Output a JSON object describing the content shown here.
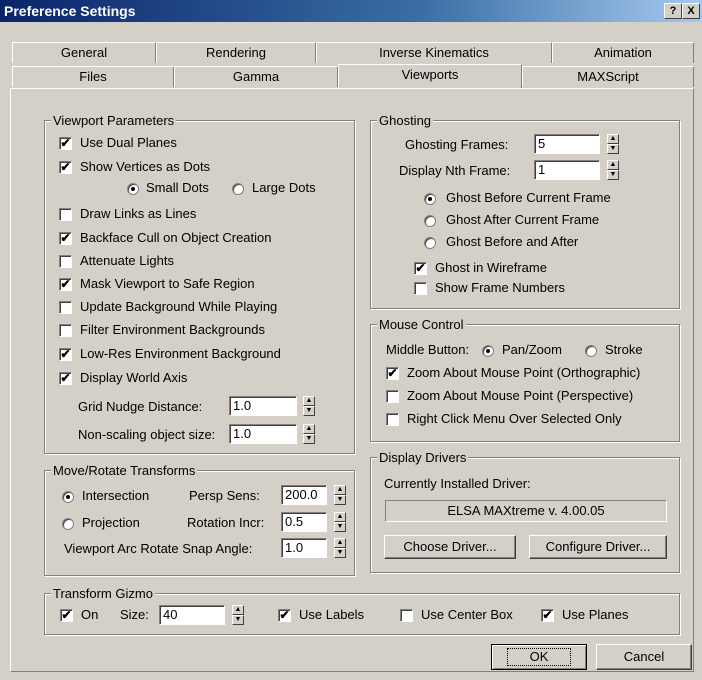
{
  "window": {
    "title": "Preference Settings",
    "help_label": "?",
    "close_label": "X"
  },
  "tabs_row1": [
    "General",
    "Rendering",
    "Inverse Kinematics",
    "Animation"
  ],
  "tabs_row2": [
    "Files",
    "Gamma",
    "Viewports",
    "MAXScript"
  ],
  "viewport_params": {
    "title": "Viewport Parameters",
    "use_dual_planes": "Use Dual Planes",
    "show_vertices": "Show Vertices as Dots",
    "small_dots": "Small Dots",
    "large_dots": "Large Dots",
    "draw_links": "Draw Links as Lines",
    "backface_cull": "Backface Cull on Object Creation",
    "attenuate_lights": "Attenuate Lights",
    "mask_viewport": "Mask Viewport to Safe Region",
    "update_background": "Update Background While Playing",
    "filter_env": "Filter Environment Backgrounds",
    "lowres_env": "Low-Res Environment Background",
    "display_world_axis": "Display World Axis",
    "grid_nudge_label": "Grid Nudge Distance:",
    "grid_nudge_value": "1.0",
    "nonscaling_label": "Non-scaling object size:",
    "nonscaling_value": "1.0"
  },
  "ghosting": {
    "title": "Ghosting",
    "frames_label": "Ghosting Frames:",
    "frames_value": "5",
    "nth_label": "Display Nth Frame:",
    "nth_value": "1",
    "before": "Ghost Before Current Frame",
    "after": "Ghost After Current Frame",
    "before_after": "Ghost Before and After",
    "wireframe": "Ghost in Wireframe",
    "show_numbers": "Show Frame Numbers"
  },
  "mouse": {
    "title": "Mouse Control",
    "middle_label": "Middle Button:",
    "panzoom": "Pan/Zoom",
    "stroke": "Stroke",
    "zoom_ortho": "Zoom About Mouse Point (Orthographic)",
    "zoom_persp": "Zoom About Mouse Point (Perspective)",
    "right_click": "Right Click Menu Over Selected Only"
  },
  "move_rotate": {
    "title": "Move/Rotate Transforms",
    "intersection": "Intersection",
    "projection": "Projection",
    "persp_label": "Persp Sens:",
    "persp_value": "200.0",
    "rot_label": "Rotation Incr:",
    "rot_value": "0.5",
    "arc_label": "Viewport Arc Rotate Snap Angle:",
    "arc_value": "1.0"
  },
  "drivers": {
    "title": "Display Drivers",
    "installed_label": "Currently Installed Driver:",
    "driver_name": "ELSA MAXtreme v. 4.00.05",
    "choose": "Choose Driver...",
    "configure": "Configure Driver..."
  },
  "gizmo": {
    "title": "Transform Gizmo",
    "on": "On",
    "size_label": "Size:",
    "size_value": "40",
    "use_labels": "Use Labels",
    "use_center": "Use Center Box",
    "use_planes": "Use Planes"
  },
  "footer": {
    "ok": "OK",
    "cancel": "Cancel"
  },
  "check_mark": "✔",
  "spin_up": "▲",
  "spin_down": "▼"
}
